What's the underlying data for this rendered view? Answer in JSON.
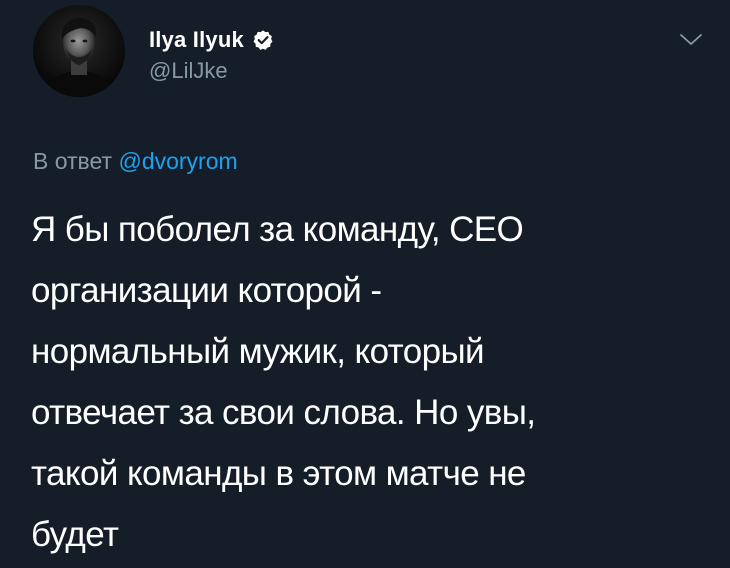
{
  "author": {
    "name": "Ilya Ilyuk",
    "handle": "@LilJke",
    "verified": true,
    "avatar_icon": "profile-photo"
  },
  "reply_context": {
    "prefix": "В ответ",
    "mention": "@dvoryrom"
  },
  "tweet": {
    "lines": [
      "Я бы поболел за команду, CEO",
      "организации которой -",
      "нормальный мужик, который",
      "отвечает за свои слова. Но увы,",
      "такой команды в этом матче не",
      "будет"
    ]
  },
  "colors": {
    "background": "#151e28",
    "text_primary": "#ffffff",
    "text_secondary": "#8899a6",
    "accent": "#1da1f2",
    "verified_badge": "#ffffff"
  },
  "icons": {
    "verified": "verified-badge-icon",
    "menu": "chevron-down-icon"
  }
}
